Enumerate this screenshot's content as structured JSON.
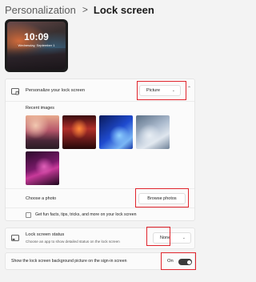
{
  "breadcrumb": {
    "parent": "Personalization",
    "separator": ">",
    "current": "Lock screen"
  },
  "preview": {
    "time": "10:09",
    "date": "Wednesday, September 1"
  },
  "personalize": {
    "label": "Personalize your lock screen",
    "selected": "Picture",
    "recent_images_label": "Recent images",
    "choose_photo_label": "Choose a photo",
    "browse_button": "Browse photos",
    "fun_facts_label": "Get fun facts, tips, tricks, and more on your lock screen"
  },
  "status": {
    "label": "Lock screen status",
    "sublabel": "Choose an app to show detailed status on the lock screen",
    "selected": "None"
  },
  "signin": {
    "label": "Show the lock screen background picture on the sign-in screen",
    "toggle_text": "On",
    "toggle_on": true
  },
  "icons": {
    "chevron_down": "⌄",
    "chevron_up": "⌃"
  },
  "colors": {
    "highlight": "#e0242c",
    "toggle_on": "#3b3b3b"
  }
}
